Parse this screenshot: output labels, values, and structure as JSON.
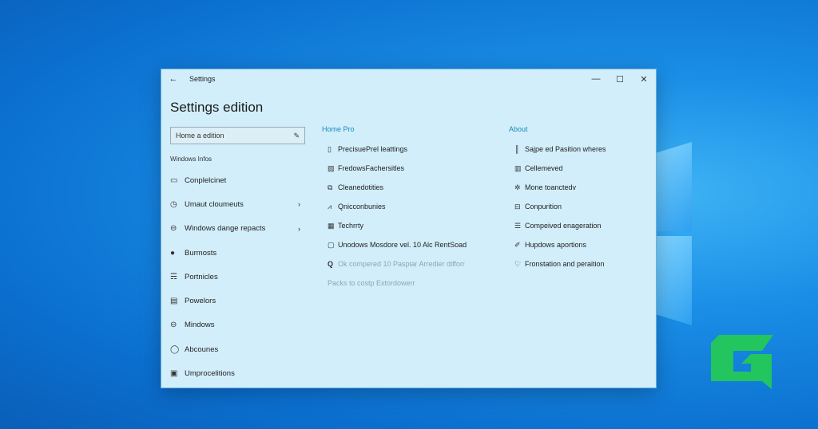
{
  "window": {
    "title": "Settings",
    "heading": "Settings edition",
    "controls": [
      "—",
      "☐",
      "✕"
    ]
  },
  "search": {
    "value": "Home a edition"
  },
  "sidebar": {
    "section": "Windows Infos",
    "items": [
      {
        "label": "Conplelcinet",
        "icon": "calendar-icon",
        "chev": false
      },
      {
        "label": "Umaut cloumeuts",
        "icon": "clock-icon",
        "chev": true
      },
      {
        "label": "Windows dange repacts",
        "icon": "globe-icon",
        "chev": true
      },
      {
        "label": "Burmosts",
        "icon": "dot-icon",
        "chev": false
      },
      {
        "label": "Portnicles",
        "icon": "cap-icon",
        "chev": false
      },
      {
        "label": "Powelors",
        "icon": "panel-icon",
        "chev": false
      },
      {
        "label": "Mindows",
        "icon": "globe-icon",
        "chev": false
      },
      {
        "label": "Abcounes",
        "icon": "shield-icon",
        "chev": false
      },
      {
        "label": "Umprocelitions",
        "icon": "monitor-icon",
        "chev": false
      }
    ]
  },
  "home_pro": {
    "heading": "Home Pro",
    "items": [
      {
        "label": "PrecisuePrel leattings",
        "icon": "display-icon"
      },
      {
        "label": "FredowsFachersitles",
        "icon": "image-icon"
      },
      {
        "label": "Cleanedotities",
        "icon": "copy-icon"
      },
      {
        "label": "Qnicconbunies",
        "icon": "chart-icon"
      },
      {
        "label": "Techrrty",
        "icon": "grid-icon"
      },
      {
        "label": "Unodows Mosdore vel. 10 Alc RentSoad",
        "icon": "clipboard-icon"
      },
      {
        "label": "Ok compered 10 Paspiar Arredier difforr",
        "icon": "search-icon"
      }
    ],
    "footer": "Packs to costp Extordowerr"
  },
  "about": {
    "heading": "About",
    "items": [
      {
        "label": "Sajpe ed Pasition wheres",
        "icon": "bars-icon"
      },
      {
        "label": "Cellemeved",
        "icon": "info-icon"
      },
      {
        "label": "Mone toanctedv",
        "icon": "gear-icon"
      },
      {
        "label": "Conpurition",
        "icon": "user-icon"
      },
      {
        "label": "Compeived enageration",
        "icon": "list-icon"
      },
      {
        "label": "Hupdows aportions",
        "icon": "pen-icon"
      },
      {
        "label": "Fronstation and peraition",
        "icon": "heart-icon"
      }
    ]
  },
  "glyphs": {
    "back": "←",
    "edit": "✎",
    "chev": "›",
    "cal": "▭",
    "clock": "◷",
    "globe": "⊖",
    "dot": "●",
    "cap": "☴",
    "panel": "▤",
    "shield": "◯",
    "monitor": "▣",
    "display": "▯",
    "image": "▨",
    "copy": "⧉",
    "chart": "⩘",
    "grid": "▦",
    "clip": "▢",
    "search": "Q",
    "bars": "║",
    "info": "▥",
    "gear": "✲",
    "user": "⊟",
    "list": "☰",
    "pen": "✐",
    "heart": "♡"
  }
}
